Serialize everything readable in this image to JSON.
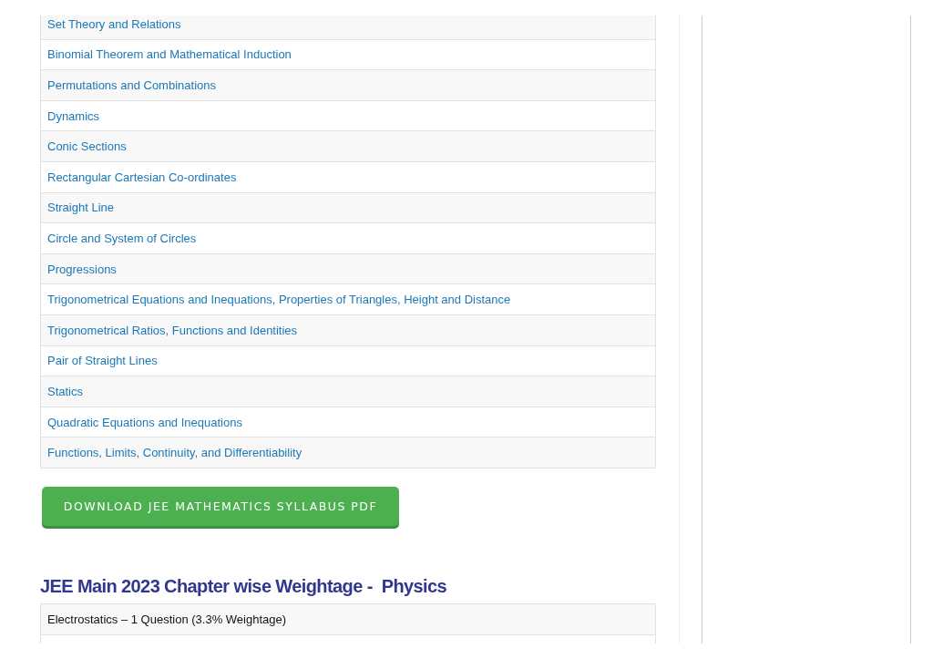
{
  "math_topics": [
    "Set Theory and Relations",
    "Binomial Theorem and Mathematical Induction",
    "Permutations and Combinations",
    "Dynamics",
    "Conic Sections",
    "Rectangular Cartesian Co-ordinates",
    "Straight Line",
    "Circle and System of Circles",
    "Progressions",
    "Trigonometrical Equations and Inequations, Properties of Triangles, Height and Distance",
    "Trigonometrical Ratios, Functions and Identities",
    "Pair of Straight Lines",
    "Statics",
    "Quadratic Equations and Inequations",
    "Functions, Limits, Continuity, and Differentiability"
  ],
  "download_button": {
    "label": "DOWNLOAD JEE MATHEMATICS SYLLABUS PDF"
  },
  "physics_heading": "JEE Main 2023 Chapter wise Weightage -  Physics",
  "physics_rows": [
    "Electrostatics – 1 Question (3.3% Weightage)"
  ]
}
